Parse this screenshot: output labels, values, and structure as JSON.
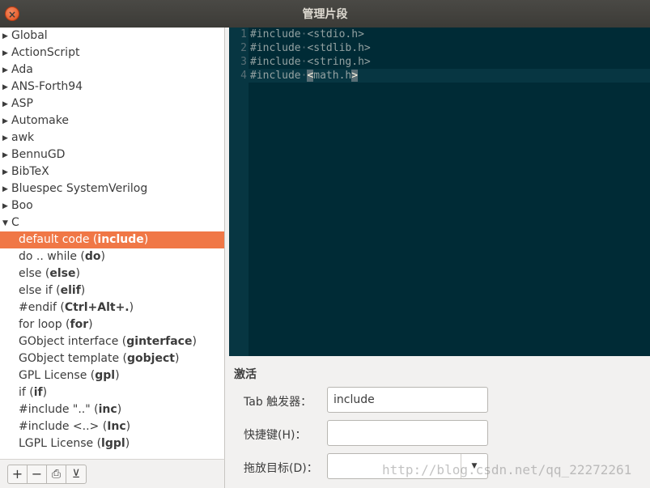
{
  "window": {
    "title": "管理片段",
    "close_glyph": "×"
  },
  "tree": {
    "groups_before": [
      "Global",
      "ActionScript",
      "Ada",
      "ANS-Forth94",
      "ASP",
      "Automake",
      "awk",
      "BennuGD",
      "BibTeX",
      "Bluespec SystemVerilog",
      "Boo"
    ],
    "expanded_group": "C",
    "children": [
      {
        "name": "default code",
        "trigger": "include",
        "selected": true
      },
      {
        "name": "do .. while",
        "trigger": "do"
      },
      {
        "name": "else",
        "trigger": "else"
      },
      {
        "name": "else if",
        "trigger": "elif"
      },
      {
        "name": "#endif",
        "trigger": "Ctrl+Alt+."
      },
      {
        "name": "for loop",
        "trigger": "for"
      },
      {
        "name": "GObject interface",
        "trigger": "ginterface"
      },
      {
        "name": "GObject template",
        "trigger": "gobject"
      },
      {
        "name": "GPL License",
        "trigger": "gpl"
      },
      {
        "name": "if",
        "trigger": "if"
      },
      {
        "name": "#include \"..\"",
        "trigger": "inc"
      },
      {
        "name": "#include <..>",
        "trigger": "Inc"
      },
      {
        "name": "LGPL License",
        "trigger": "lgpl"
      }
    ],
    "icons": {
      "collapsed": "chevron-right-icon",
      "expanded": "chevron-down-icon"
    }
  },
  "toolbar": {
    "add_glyph": "+",
    "remove_glyph": "−",
    "import_glyph": "⎙",
    "export_glyph": "⊻"
  },
  "editor": {
    "lines": [
      {
        "no": "1",
        "kw": "#include",
        "arg": "<stdio.h>"
      },
      {
        "no": "2",
        "kw": "#include",
        "arg": "<stdlib.h>"
      },
      {
        "no": "3",
        "kw": "#include",
        "arg": "<string.h>"
      },
      {
        "no": "4",
        "kw": "#include",
        "arg_mark": "<",
        "arg_rest": "math.h",
        "arg_mark_end": ">"
      }
    ],
    "space_marker": "·",
    "colors": {
      "background": "#002b36",
      "gutter": "#073642",
      "text": "#93a1a1"
    }
  },
  "activation": {
    "title": "激活",
    "tab_trigger_label": "Tab 触发器：",
    "tab_trigger_value": "include",
    "shortcut_label": "快捷键(H)：",
    "shortcut_value": "",
    "drop_target_label": "拖放目标(D)：",
    "drop_target_value": ""
  },
  "watermark": "http://blog.csdn.net/qq_22272261",
  "colors": {
    "selection": "#f07746",
    "titlebar": "#3c3b37",
    "close_button": "#e0501a"
  }
}
